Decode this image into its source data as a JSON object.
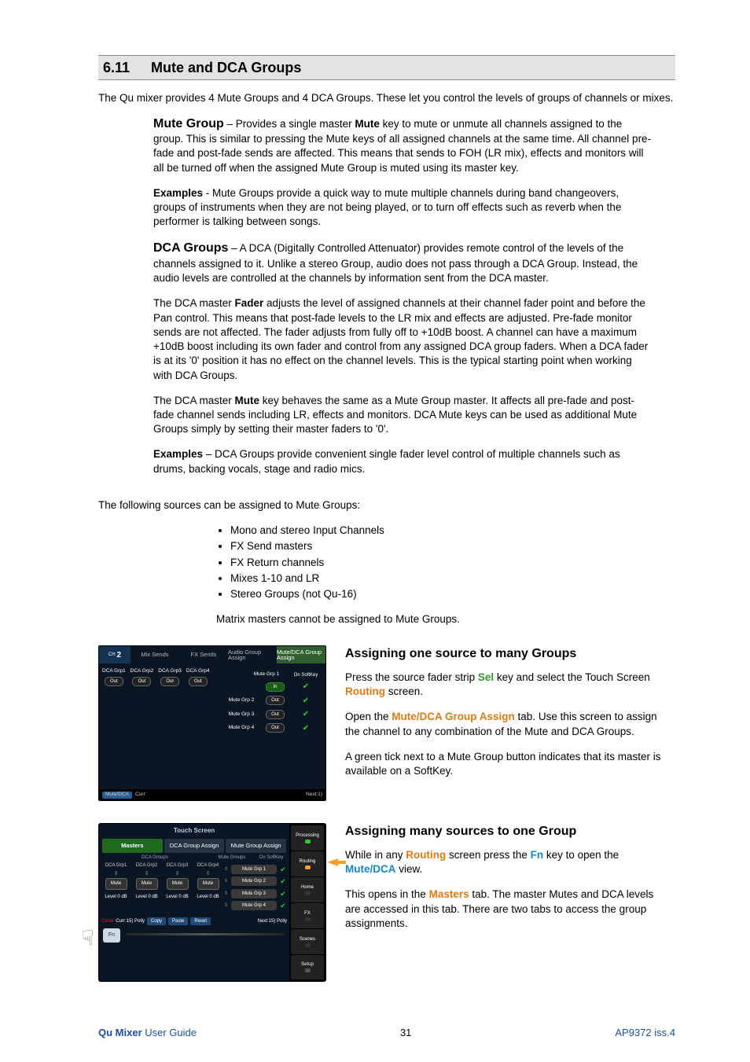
{
  "section": {
    "number": "6.11",
    "title": "Mute and DCA Groups"
  },
  "intro": "The Qu mixer provides 4 Mute Groups and 4 DCA Groups. These let you control the levels of groups of channels or mixes.",
  "mute_group": {
    "heading": "Mute Group",
    "p1a": " – Provides a single master ",
    "mute_bold": "Mute",
    "p1b": " key to mute or unmute all channels assigned to the group. This is similar to pressing the Mute keys of all assigned channels at the same time. All channel pre-fade and post-fade sends are affected. This means that sends to FOH (LR mix), effects and monitors will all be turned off when the assigned Mute Group is muted using its master key.",
    "examples_label": "Examples",
    "examples": " - Mute Groups provide a quick way to mute multiple channels during band changeovers, groups of instruments when they are not being played, or to turn off effects such as reverb when the performer is talking between songs."
  },
  "dca_groups": {
    "heading": "DCA Groups",
    "p1": " – A DCA (Digitally Controlled Attenuator) provides remote control of the levels of the channels assigned to it. Unlike a stereo Group, audio does not pass through a DCA Group. Instead, the audio levels are controlled at the channels by information sent from the DCA master.",
    "p2a": "The DCA master ",
    "fader_bold": "Fader",
    "p2b": " adjusts the level of assigned channels at their channel fader point and before the Pan control. This means that post-fade levels to the LR mix and effects are adjusted. Pre-fade monitor sends are not affected. The fader adjusts from fully off to +10dB boost. A channel can have a maximum +10dB boost including its own fader and control from any assigned DCA group faders. When a DCA fader is at its '0' position it has no effect on the channel levels. This is the typical starting point when working with DCA Groups.",
    "p3a": "The DCA master ",
    "mute_bold": "Mute",
    "p3b": " key behaves the same as a Mute Group master. It affects all pre-fade and post-fade channel sends including LR, effects and monitors. DCA Mute keys can be used as additional Mute Groups simply by setting their master faders to '0'.",
    "examples_label": "Examples",
    "examples": " – DCA Groups provide convenient single fader level control of multiple channels such as drums, backing vocals, stage and radio mics."
  },
  "sources": {
    "lead": "The following sources can be assigned to Mute Groups:",
    "items": [
      "Mono and stereo Input Channels",
      "FX Send masters",
      "FX Return channels",
      "Mixes 1-10 and LR",
      "Stereo Groups (not Qu-16)"
    ],
    "matrix": "Matrix masters cannot be assigned to Mute Groups."
  },
  "assign_one": {
    "title": "Assigning one source to many Groups",
    "p1a": "Press the source fader strip ",
    "sel": "Sel",
    "p1b": " key and select the Touch Screen ",
    "routing": "Routing",
    "p1c": " screen.",
    "p2a": "Open the ",
    "tab": "Mute/DCA Group Assign",
    "p2b": " tab. Use this screen to assign the channel to any combination of the Mute and DCA Groups.",
    "p3": "A green tick next to a Mute Group button indicates that its master is available on a SoftKey."
  },
  "assign_many": {
    "title": "Assigning many sources to one Group",
    "p1a": "While in any ",
    "routing": "Routing",
    "p1b": " screen press the ",
    "fn": "Fn",
    "p1c": " key to open the ",
    "view": "Mute/DCA",
    "p1d": " view.",
    "p2a": "This opens in the ",
    "masters": "Masters",
    "p2b": " tab. The master Mutes and DCA levels are accessed in this tab. There are two tabs to access the group assignments."
  },
  "mock1": {
    "ch": "CH 2",
    "tabs": [
      "Mix Sends",
      "FX Sends",
      "Audio Group Assign",
      "Mute/DCA Group Assign"
    ],
    "dca": [
      "DCA Grp1",
      "DCA Grp2",
      "DCA Grp3",
      "DCA Grp4"
    ],
    "out": "Out",
    "softkey_hdr": "On SoftKey",
    "mutes": [
      {
        "label": "Mute Grp 1",
        "state": "In",
        "check": true
      },
      {
        "label": "Mute Grp 2",
        "state": "Out",
        "check": true
      },
      {
        "label": "Mute Grp 3",
        "state": "Out",
        "check": true
      },
      {
        "label": "Mute Grp 4",
        "state": "Out",
        "check": true
      }
    ],
    "footer_md": "Mute/DCA",
    "footer_curr": "Curr:",
    "footer_next": "Next:1)"
  },
  "mock2": {
    "title": "Touch Screen",
    "tabs": [
      "Masters",
      "DCA Group Assign",
      "Mute Group Assign"
    ],
    "sub": [
      "DCA Groups",
      "Mute Groups",
      "On SoftKey"
    ],
    "dca_hdr": [
      "DCA Grp1",
      "DCA Grp2",
      "DCA Grp3",
      "DCA Grp4"
    ],
    "mute": "Mute",
    "level": "Level 0 dB",
    "mgroups": [
      "Mute Grp 1",
      "Mute Grp 2",
      "Mute Grp 3",
      "Mute Grp 4"
    ],
    "bottom": {
      "close": "Close",
      "curr": "Curr:15) Polly",
      "copy": "Copy",
      "paste": "Paste",
      "reset": "Reset",
      "next": "Next:15) Polly",
      "fn": "Fn"
    },
    "right": [
      "Processing",
      "Routing",
      "Home",
      "FX",
      "Scenes",
      "Setup"
    ]
  },
  "footer": {
    "left_bold": "Qu Mixer",
    "left_rest": " User Guide",
    "page": "31",
    "right": "AP9372 iss.4"
  }
}
